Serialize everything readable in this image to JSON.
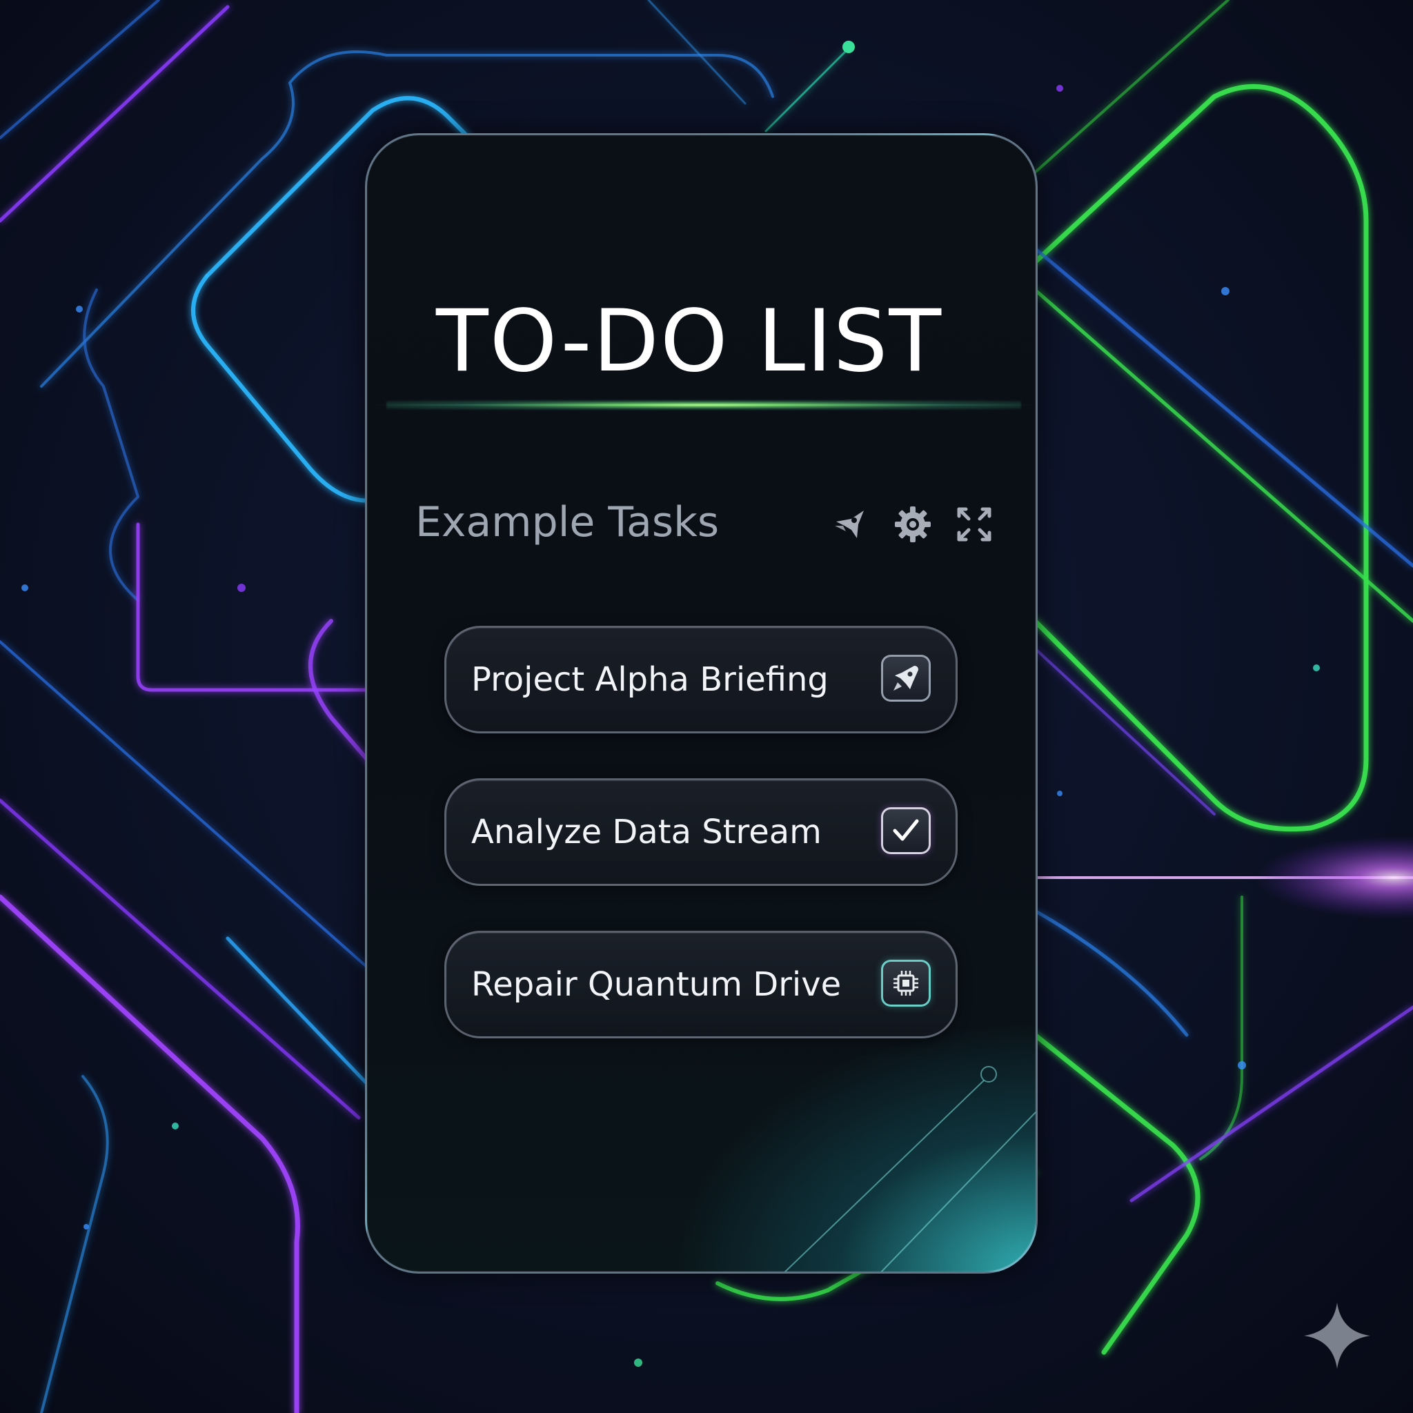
{
  "header": {
    "title": "TO-DO LIST",
    "section_title": "Example Tasks",
    "icons": [
      "rocket-icon",
      "gear-icon",
      "expand-icon"
    ]
  },
  "tasks": [
    {
      "label": "Project Alpha Briefing",
      "icon": "rocket-icon",
      "completed": false
    },
    {
      "label": "Analyze Data Stream",
      "icon": "checkmark-icon",
      "completed": true
    },
    {
      "label": "Repair Quantum Drive",
      "icon": "chip-icon",
      "completed": false
    }
  ],
  "colors": {
    "background": "#0a0e1c",
    "card": "#0b0f16",
    "title_text": "#ffffff",
    "section_text": "#9ea6b2",
    "task_text": "#f2f4f7",
    "neon_blue": "#2aa8ff",
    "neon_purple": "#a23cff",
    "neon_green": "#3ee65a",
    "neon_teal": "#3ae0d8"
  }
}
